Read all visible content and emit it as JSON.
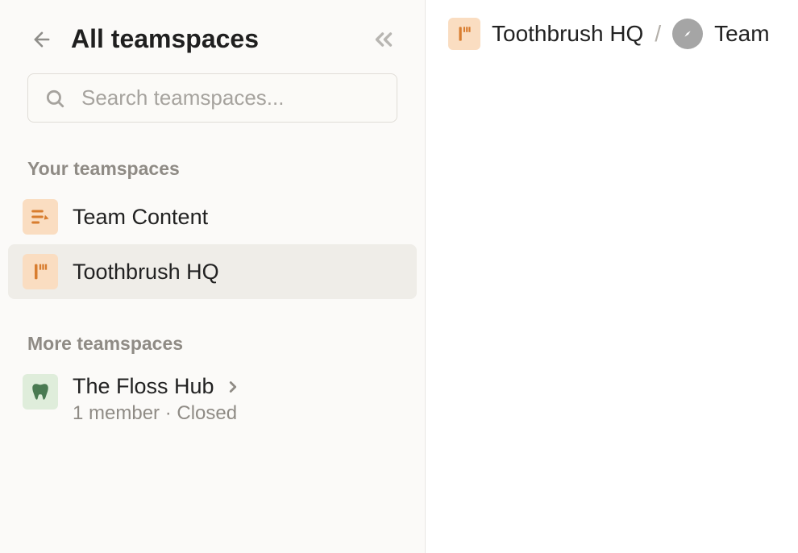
{
  "sidebar": {
    "title": "All teamspaces",
    "search_placeholder": "Search teamspaces...",
    "your_label": "Your teamspaces",
    "more_label": "More teamspaces",
    "items": [
      {
        "name": "Team Content",
        "icon": "document-edit",
        "bg": "orange"
      },
      {
        "name": "Toothbrush HQ",
        "icon": "toothbrush",
        "bg": "orange",
        "selected": true
      }
    ],
    "more_items": [
      {
        "name": "The Floss Hub",
        "icon": "tooth",
        "bg": "green",
        "meta": "1 member · Closed"
      }
    ]
  },
  "breadcrumb": {
    "root_name": "Toothbrush HQ",
    "child_name": "Team"
  }
}
